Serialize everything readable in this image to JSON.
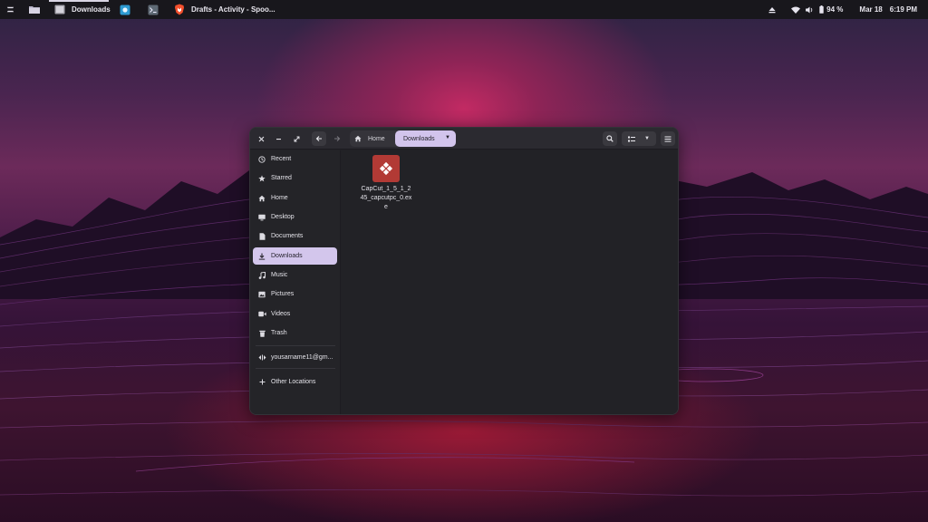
{
  "topbar": {
    "active_app_label": "Downloads",
    "browser_window_label": "Drafts - Activity - Spoo...",
    "battery": "94 %",
    "date": "Mar 18",
    "time": "6:19 PM"
  },
  "window": {
    "controls": {
      "close": "close-icon",
      "minimize": "minimize-icon",
      "restore": "restore-icon"
    },
    "path": {
      "home_label": "Home",
      "current_label": "Downloads"
    }
  },
  "sidebar": {
    "items": [
      {
        "label": "Recent",
        "icon": "clock-icon"
      },
      {
        "label": "Starred",
        "icon": "star-icon"
      },
      {
        "label": "Home",
        "icon": "home-icon"
      },
      {
        "label": "Desktop",
        "icon": "desktop-icon"
      },
      {
        "label": "Documents",
        "icon": "document-icon"
      },
      {
        "label": "Downloads",
        "icon": "download-icon",
        "active": true
      },
      {
        "label": "Music",
        "icon": "music-icon"
      },
      {
        "label": "Pictures",
        "icon": "picture-icon"
      },
      {
        "label": "Videos",
        "icon": "video-icon"
      },
      {
        "label": "Trash",
        "icon": "trash-icon"
      }
    ],
    "network_item": {
      "label": "yousarname11@gm...",
      "icon": "network-share-icon"
    },
    "other_locations": {
      "label": "Other Locations",
      "icon": "plus-icon"
    }
  },
  "files": [
    {
      "name": "CapCut_1_5_1_245_capcutpc_0.exe",
      "icon": "executable-icon"
    }
  ],
  "colors": {
    "accent": "#d3c6ec",
    "topbar": "#18171c",
    "window_bg": "#222226",
    "file_icon": "#b23a35"
  }
}
